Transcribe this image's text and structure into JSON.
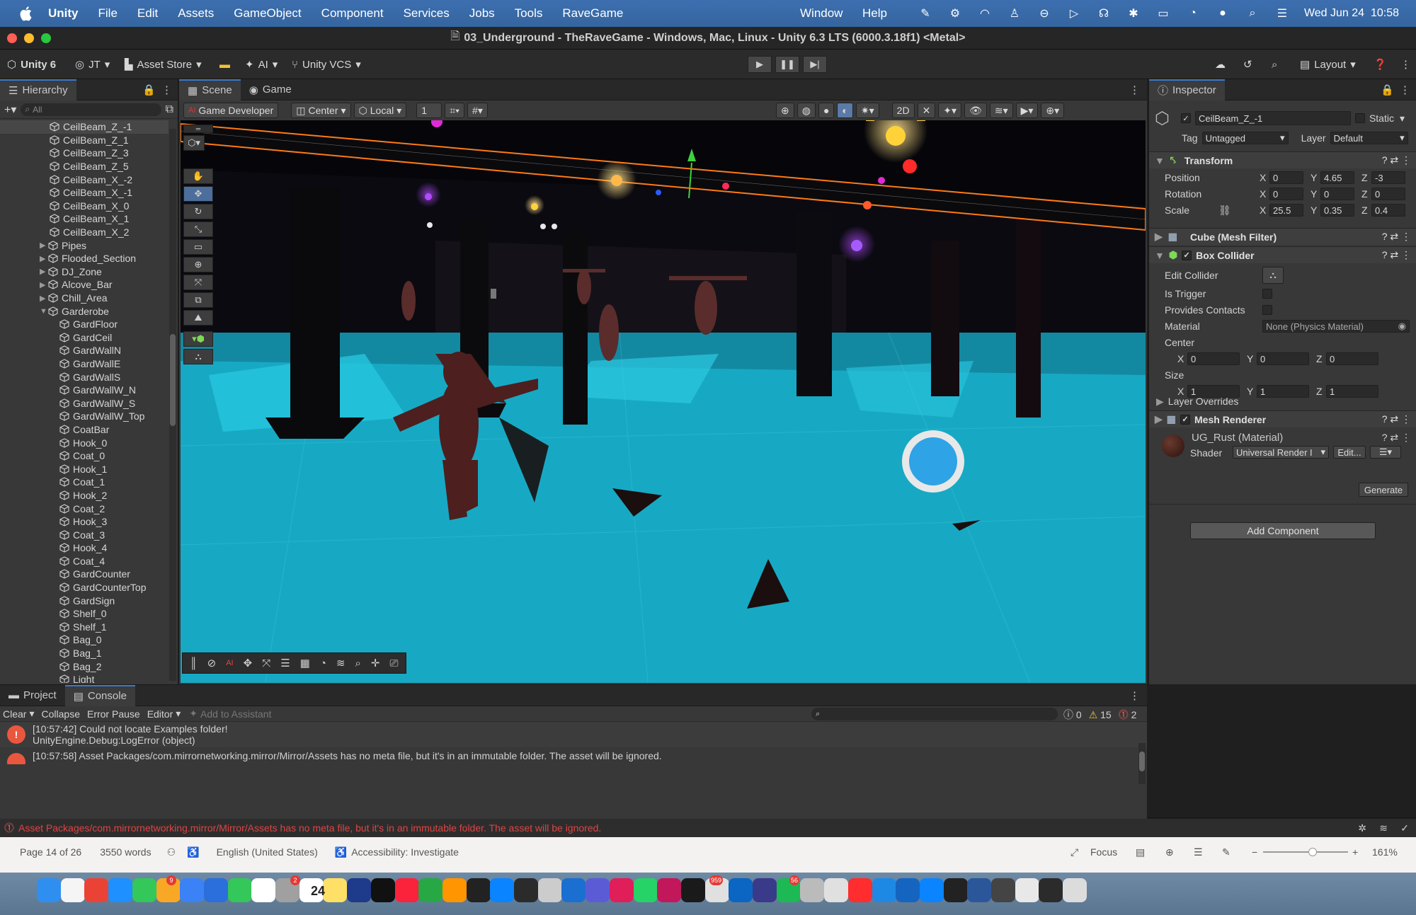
{
  "menubar": {
    "app": "Unity",
    "items": [
      "File",
      "Edit",
      "Assets",
      "GameObject",
      "Component",
      "Services",
      "Jobs",
      "Tools",
      "RaveGame"
    ],
    "right_items": [
      "Window",
      "Help"
    ],
    "clock": "Wed Jun 24  10:58"
  },
  "window": {
    "title": "03_Underground - TheRaveGame - Windows, Mac, Linux - Unity 6.3 LTS (6000.3.18f1) <Metal>"
  },
  "toolbar": {
    "unity_label": "Unity 6",
    "account": "JT",
    "asset_store": "Asset Store",
    "ai": "AI",
    "vcs": "Unity VCS",
    "layout": "Layout"
  },
  "hierarchy": {
    "tab": "Hierarchy",
    "search_placeholder": "All",
    "items": [
      {
        "label": "CeilBeam_Z_-1",
        "indent": 1,
        "sel": true
      },
      {
        "label": "CeilBeam_Z_1",
        "indent": 1
      },
      {
        "label": "CeilBeam_Z_3",
        "indent": 1
      },
      {
        "label": "CeilBeam_Z_5",
        "indent": 1
      },
      {
        "label": "CeilBeam_X_-2",
        "indent": 1
      },
      {
        "label": "CeilBeam_X_-1",
        "indent": 1
      },
      {
        "label": "CeilBeam_X_0",
        "indent": 1
      },
      {
        "label": "CeilBeam_X_1",
        "indent": 1
      },
      {
        "label": "CeilBeam_X_2",
        "indent": 1
      },
      {
        "label": "Pipes",
        "indent": 1,
        "fold": "▶"
      },
      {
        "label": "Flooded_Section",
        "indent": 1,
        "fold": "▶"
      },
      {
        "label": "DJ_Zone",
        "indent": 1,
        "fold": "▶"
      },
      {
        "label": "Alcove_Bar",
        "indent": 1,
        "fold": "▶"
      },
      {
        "label": "Chill_Area",
        "indent": 1,
        "fold": "▶"
      },
      {
        "label": "Garderobe",
        "indent": 1,
        "fold": "▼"
      },
      {
        "label": "GardFloor",
        "indent": 2
      },
      {
        "label": "GardCeil",
        "indent": 2
      },
      {
        "label": "GardWallN",
        "indent": 2
      },
      {
        "label": "GardWallE",
        "indent": 2
      },
      {
        "label": "GardWallS",
        "indent": 2
      },
      {
        "label": "GardWallW_N",
        "indent": 2
      },
      {
        "label": "GardWallW_S",
        "indent": 2
      },
      {
        "label": "GardWallW_Top",
        "indent": 2
      },
      {
        "label": "CoatBar",
        "indent": 2
      },
      {
        "label": "Hook_0",
        "indent": 2
      },
      {
        "label": "Coat_0",
        "indent": 2
      },
      {
        "label": "Hook_1",
        "indent": 2
      },
      {
        "label": "Coat_1",
        "indent": 2
      },
      {
        "label": "Hook_2",
        "indent": 2
      },
      {
        "label": "Coat_2",
        "indent": 2
      },
      {
        "label": "Hook_3",
        "indent": 2
      },
      {
        "label": "Coat_3",
        "indent": 2
      },
      {
        "label": "Hook_4",
        "indent": 2
      },
      {
        "label": "Coat_4",
        "indent": 2
      },
      {
        "label": "GardCounter",
        "indent": 2
      },
      {
        "label": "GardCounterTop",
        "indent": 2
      },
      {
        "label": "GardSign",
        "indent": 2
      },
      {
        "label": "Shelf_0",
        "indent": 2
      },
      {
        "label": "Shelf_1",
        "indent": 2
      },
      {
        "label": "Bag_0",
        "indent": 2
      },
      {
        "label": "Bag_1",
        "indent": 2
      },
      {
        "label": "Bag_2",
        "indent": 2
      },
      {
        "label": "Light",
        "indent": 2
      }
    ]
  },
  "scene": {
    "tabs": [
      "Scene",
      "Game"
    ],
    "overlay": "Game Developer",
    "pivot": "Center",
    "space": "Local",
    "grid_increment": "1"
  },
  "inspector": {
    "tab": "Inspector",
    "object_name": "CeilBeam_Z_-1",
    "static_label": "Static",
    "tag_label": "Tag",
    "tag_value": "Untagged",
    "layer_label": "Layer",
    "layer_value": "Default",
    "transform": {
      "title": "Transform",
      "position_label": "Position",
      "rotation_label": "Rotation",
      "scale_label": "Scale",
      "position": {
        "x": "0",
        "y": "4.65",
        "z": "-3"
      },
      "rotation": {
        "x": "0",
        "y": "0",
        "z": "0"
      },
      "scale": {
        "x": "25.5",
        "y": "0.35",
        "z": "0.4"
      }
    },
    "mesh_filter": "Cube (Mesh Filter)",
    "box_collider": {
      "title": "Box Collider",
      "edit_collider": "Edit Collider",
      "is_trigger": "Is Trigger",
      "provides_contacts": "Provides Contacts",
      "material_label": "Material",
      "material_value": "None (Physics Material)",
      "center_label": "Center",
      "center": {
        "x": "0",
        "y": "0",
        "z": "0"
      },
      "size_label": "Size",
      "size": {
        "x": "1",
        "y": "1",
        "z": "1"
      },
      "layer_overrides": "Layer Overrides"
    },
    "mesh_renderer": {
      "title": "Mesh Renderer",
      "material_name": "UG_Rust (Material)",
      "shader_label": "Shader",
      "shader_value": "Universal Render I",
      "edit_button": "Edit...",
      "generate_button": "Generate"
    },
    "add_component": "Add Component"
  },
  "console": {
    "tabs": [
      "Project",
      "Console"
    ],
    "clear": "Clear",
    "collapse": "Collapse",
    "error_pause": "Error Pause",
    "editor": "Editor",
    "add_to_assistant": "Add to Assistant",
    "counts": {
      "info": "0",
      "warn": "15",
      "error": "2"
    },
    "entries": [
      {
        "line1": "[10:57:42] Could not locate Examples folder!",
        "line2": "UnityEngine.Debug:LogError (object)"
      },
      {
        "line1": "[10:57:58] Asset Packages/com.mirrornetworking.mirror/Mirror/Assets has no meta file, but it's in an immutable folder. The asset will be ignored.",
        "line2": ""
      }
    ],
    "status_message": "Asset Packages/com.mirrornetworking.mirror/Mirror/Assets has no meta file, but it's in an immutable folder. The asset will be ignored."
  },
  "word_status": {
    "page": "Page 14 of 26",
    "words": "3550 words",
    "language": "English (United States)",
    "accessibility": "Accessibility: Investigate",
    "focus": "Focus",
    "zoom": "161%"
  },
  "dock": {
    "badges": [
      "9",
      "2",
      "959",
      "56"
    ],
    "calendar_day": "24"
  },
  "colors": {
    "accent": "#3a79d4",
    "floor": "#17a9c4",
    "selection_outline": "#ff7a14"
  }
}
